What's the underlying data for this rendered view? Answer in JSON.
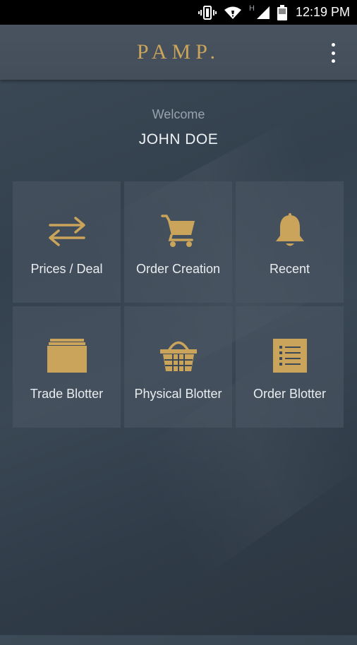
{
  "status_bar": {
    "network_type": "H",
    "time": "12:19 PM",
    "icons": [
      "vibrate-icon",
      "wifi-icon",
      "signal-icon",
      "battery-icon"
    ]
  },
  "app_bar": {
    "logo_text": "PAMP.",
    "menu_icon": "more-vert-icon"
  },
  "greeting": {
    "welcome": "Welcome",
    "user_name": "JOHN DOE"
  },
  "menu": [
    {
      "label": "Prices / Deal",
      "icon": "swap-arrows-icon"
    },
    {
      "label": "Order Creation",
      "icon": "cart-icon"
    },
    {
      "label": "Recent",
      "icon": "bell-icon"
    },
    {
      "label": "Trade Blotter",
      "icon": "folder-icon"
    },
    {
      "label": "Physical Blotter",
      "icon": "basket-icon"
    },
    {
      "label": "Order Blotter",
      "icon": "list-icon"
    }
  ],
  "colors": {
    "accent": "#c9a45a",
    "background": "#36424e",
    "tile": "#4a5662",
    "status_bar": "#000000"
  }
}
